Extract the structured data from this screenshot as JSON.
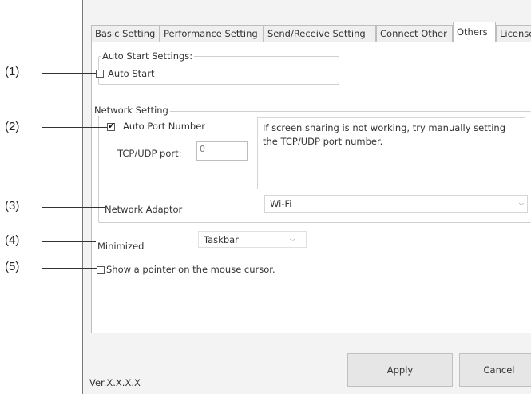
{
  "tabs": [
    "Basic Setting",
    "Performance Setting",
    "Send/Receive Setting",
    "Connect Other",
    "Others",
    "License"
  ],
  "auto_start": {
    "group_title": "Auto Start Settings:",
    "checkbox_label": "Auto Start",
    "checked": false
  },
  "network": {
    "group_title": "Network Setting",
    "auto_port_label": "Auto Port Number",
    "auto_port_checked": true,
    "port_label": "TCP/UDP port:",
    "port_value": "0",
    "info_text": "If screen sharing is not working, try manually setting the TCP/UDP port number.",
    "adaptor_label": "Network Adaptor",
    "adaptor_value": "Wi-Fi"
  },
  "minimized": {
    "label": "Minimized",
    "value": "Taskbar"
  },
  "pointer": {
    "label": "Show a pointer on the mouse cursor.",
    "checked": false
  },
  "buttons": {
    "apply": "Apply",
    "cancel": "Cancel"
  },
  "version": "Ver.X.X.X.X",
  "callouts": [
    "(1)",
    "(2)",
    "(3)",
    "(4)",
    "(5)"
  ]
}
